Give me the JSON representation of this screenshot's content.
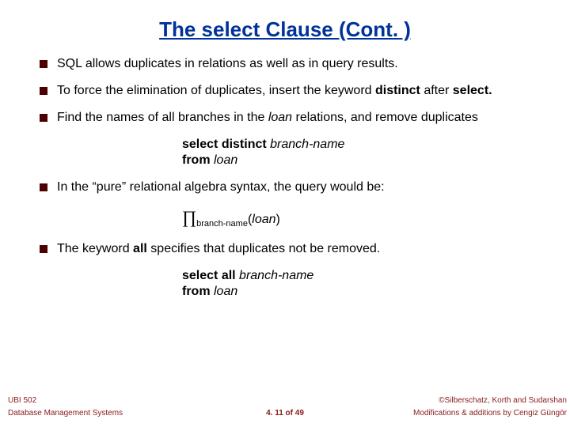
{
  "title": "The select Clause (Cont. )",
  "bullets": {
    "b1": "SQL allows duplicates in relations as well as in query results.",
    "b2_pre": "To force the elimination of duplicates, insert the keyword ",
    "b2_kw1": "distinct",
    "b2_mid": " after ",
    "b2_kw2": "select.",
    "b3_pre": "Find the names of all branches in the ",
    "b3_it": "loan",
    "b3_post": " relations, and remove duplicates",
    "code1_l1_b": "select distinct ",
    "code1_l1_i": "branch-name",
    "code1_l2_b": "from ",
    "code1_l2_i": "loan",
    "b4": "In the “pure” relational algebra syntax, the query would be:",
    "proj_pi": "∏",
    "proj_sub": "branch-name",
    "proj_open": "(",
    "proj_it": "loan",
    "proj_close": ")",
    "b5_pre": "The keyword ",
    "b5_kw": "all",
    "b5_post": " specifies that duplicates not be removed.",
    "code2_l1_b": "select all ",
    "code2_l1_i": "branch-name",
    "code2_l2_b": "from ",
    "code2_l2_i": "loan"
  },
  "footer": {
    "course": "UBI 502",
    "subtitle": "Database Management Systems",
    "page": "4. 11 of 49",
    "copyright": "©Silberschatz, Korth and Sudarshan",
    "mods": "Modifications & additions by Cengiz Güngör"
  }
}
